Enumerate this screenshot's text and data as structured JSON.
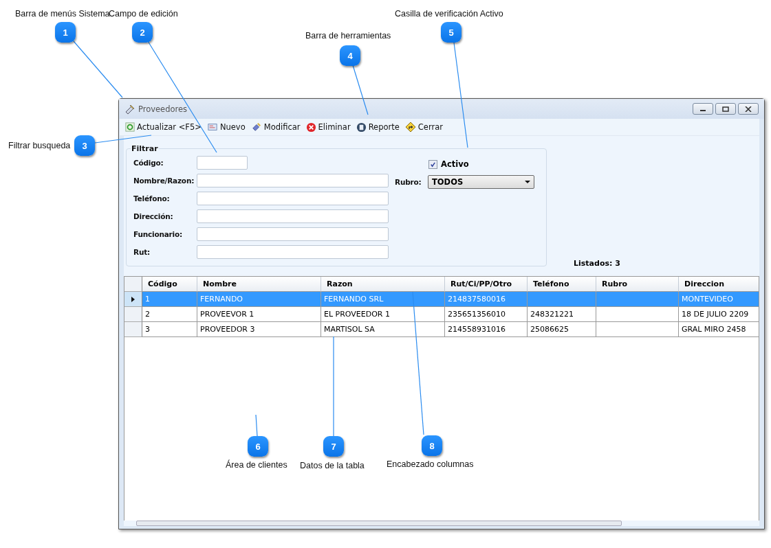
{
  "callouts": [
    {
      "number": "1",
      "label": "Barra de menús Sistema"
    },
    {
      "number": "2",
      "label": "Campo de edición"
    },
    {
      "number": "3",
      "label": "Filtrar busqueda"
    },
    {
      "number": "4",
      "label": "Barra de herramientas"
    },
    {
      "number": "5",
      "label": "Casilla de verificación Activo"
    },
    {
      "number": "6",
      "label": "Área de clientes"
    },
    {
      "number": "7",
      "label": "Datos de la tabla"
    },
    {
      "number": "8",
      "label": "Encabezado columnas"
    }
  ],
  "window": {
    "title": "Proveedores"
  },
  "toolbar": [
    {
      "label": "Actualizar <F5>",
      "kind": "refresh"
    },
    {
      "label": "Nuevo",
      "kind": "new"
    },
    {
      "label": "Modificar",
      "kind": "edit"
    },
    {
      "label": "Eliminar",
      "kind": "delete"
    },
    {
      "label": "Reporte",
      "kind": "report"
    },
    {
      "label": "Cerrar",
      "kind": "close"
    }
  ],
  "filter": {
    "title": "Filtrar",
    "fields": [
      {
        "label": "Código:",
        "kind": "short"
      },
      {
        "label": "Nombre/Razon:",
        "kind": "long"
      },
      {
        "label": "Teléfono:",
        "kind": "long"
      },
      {
        "label": "Dirección:",
        "kind": "long"
      },
      {
        "label": "Funcionario:",
        "kind": "long"
      },
      {
        "label": "Rut:",
        "kind": "long"
      }
    ],
    "active": {
      "label": "Activo",
      "checked": true
    },
    "rubro": {
      "label": "Rubro:",
      "value": "TODOS"
    }
  },
  "count": "Listados: 3",
  "table": {
    "columns": [
      "Código",
      "Nombre",
      "Razon",
      "Rut/Ci/PP/Otro",
      "Teléfono",
      "Rubro",
      "Direccion"
    ],
    "rows": [
      {
        "selected": true,
        "cells": [
          "1",
          "FERNANDO",
          "FERNANDO SRL",
          "214837580016",
          "",
          "",
          "MONTEVIDEO"
        ]
      },
      {
        "selected": false,
        "cells": [
          "2",
          "PROVEEVOR 1",
          "EL PROVEEDOR 1",
          "235651356010",
          "248321221",
          "",
          "18 DE JULIO 2209"
        ]
      },
      {
        "selected": false,
        "cells": [
          "3",
          "PROVEEDOR 3",
          "MARTISOL SA",
          "214558931016",
          "25086625",
          "",
          "GRAL MIRO 2458"
        ]
      }
    ]
  }
}
